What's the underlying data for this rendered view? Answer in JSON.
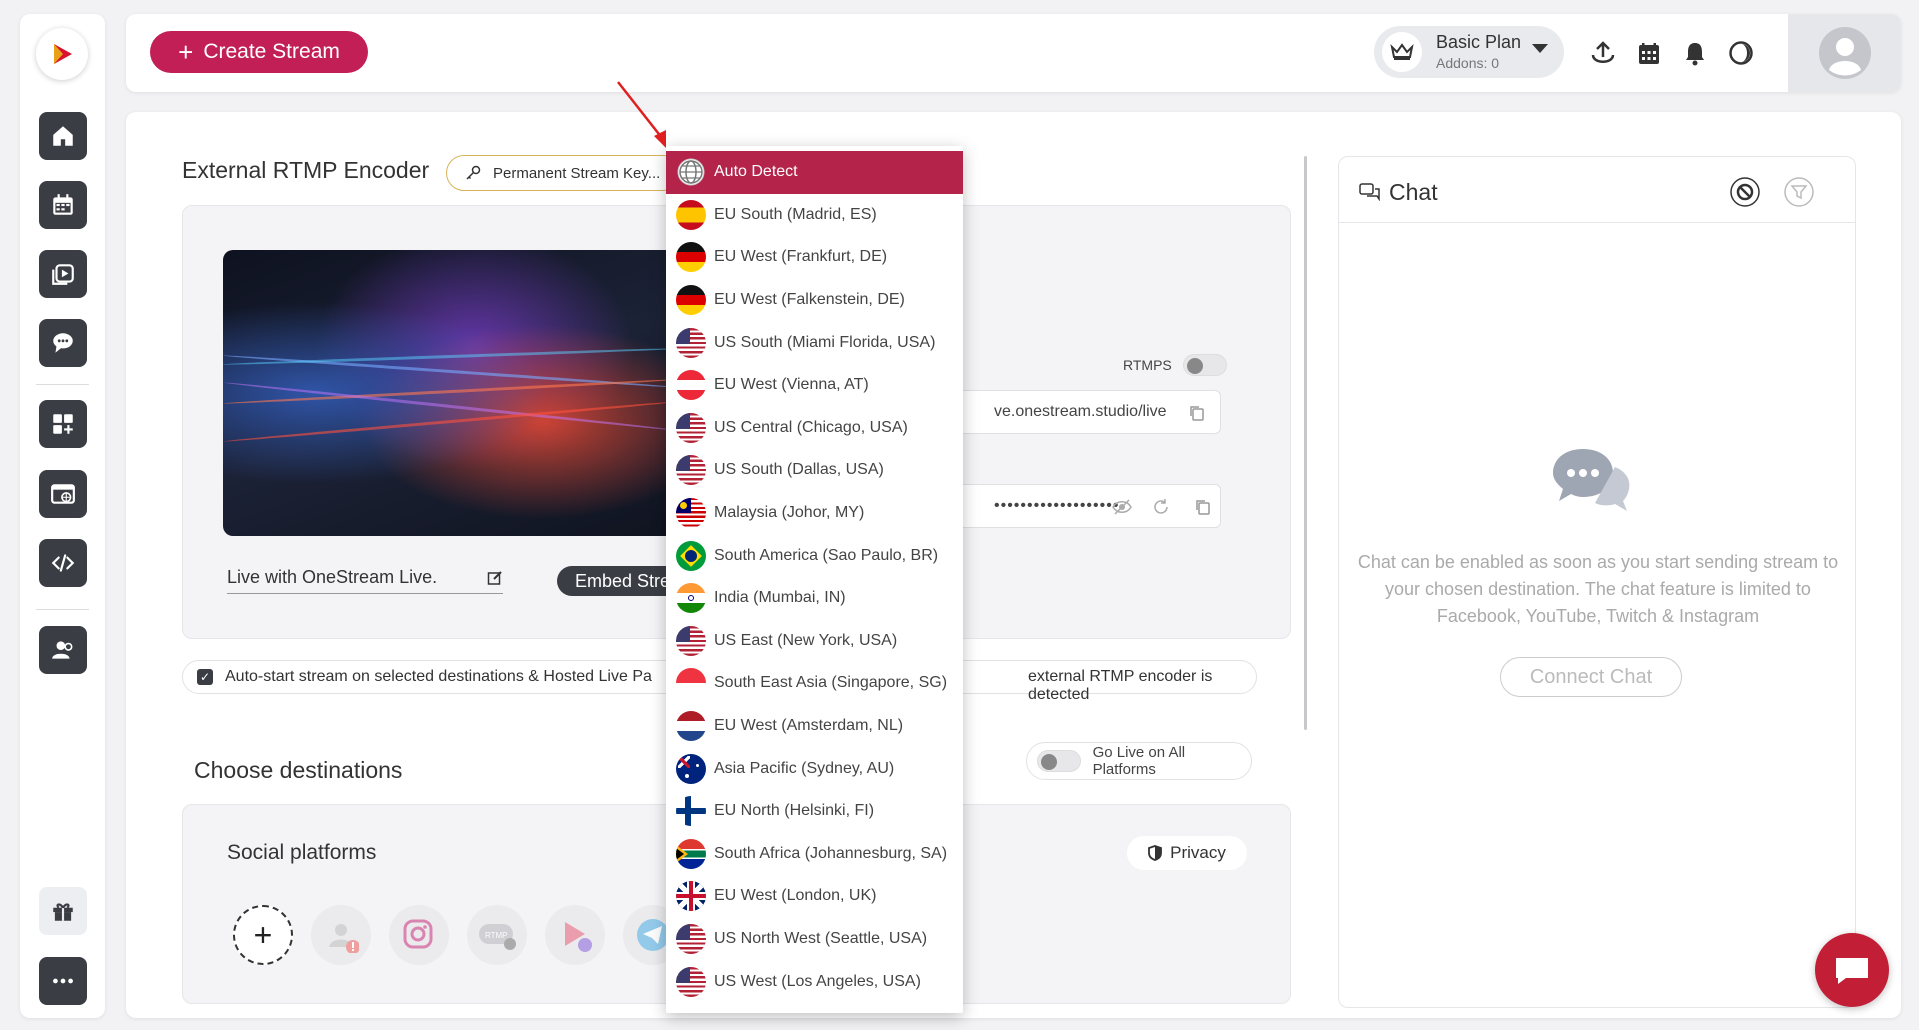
{
  "header": {
    "create_stream": "Create Stream",
    "plan_name": "Basic Plan",
    "plan_addons": "Addons: 0"
  },
  "encoder": {
    "title": "External RTMP Encoder",
    "permanent_key": "Permanent Stream Key...",
    "rtmps_label": "RTMPS",
    "server_url": "ve.onestream.studio/live",
    "stream_key_mask": "•••••••••••••••••••",
    "live_title": "Live with OneStream Live.",
    "embed_label": "Embed Stream"
  },
  "autostart": {
    "text_left": "Auto-start stream on selected destinations & Hosted Live Pa",
    "text_right": "external RTMP encoder is detected"
  },
  "destinations": {
    "title": "Choose destinations",
    "go_live_all": "Go Live on All Platforms",
    "social_title": "Social platforms",
    "privacy": "Privacy"
  },
  "chat": {
    "title": "Chat",
    "message": "Chat can be enabled as soon as you start sending stream to your chosen destination. The chat feature is limited to Facebook, YouTube, Twitch & Instagram",
    "connect": "Connect Chat"
  },
  "regions": [
    {
      "label": "Auto Detect",
      "flag": "globe"
    },
    {
      "label": "EU South (Madrid, ES)",
      "flag": "es"
    },
    {
      "label": "EU West (Frankfurt, DE)",
      "flag": "de"
    },
    {
      "label": "EU West (Falkenstein, DE)",
      "flag": "de"
    },
    {
      "label": "US South (Miami Florida, USA)",
      "flag": "us"
    },
    {
      "label": "EU West (Vienna, AT)",
      "flag": "at"
    },
    {
      "label": "US Central (Chicago, USA)",
      "flag": "us"
    },
    {
      "label": "US South (Dallas, USA)",
      "flag": "us"
    },
    {
      "label": "Malaysia (Johor, MY)",
      "flag": "my"
    },
    {
      "label": "South America (Sao Paulo, BR)",
      "flag": "br"
    },
    {
      "label": "India (Mumbai, IN)",
      "flag": "in"
    },
    {
      "label": "US East (New York, USA)",
      "flag": "us"
    },
    {
      "label": "South East Asia (Singapore, SG)",
      "flag": "sg"
    },
    {
      "label": "EU West (Amsterdam, NL)",
      "flag": "nl"
    },
    {
      "label": "Asia Pacific (Sydney, AU)",
      "flag": "au"
    },
    {
      "label": "EU North (Helsinki, FI)",
      "flag": "fi"
    },
    {
      "label": "South Africa (Johannesburg, SA)",
      "flag": "za"
    },
    {
      "label": "EU West (London, UK)",
      "flag": "uk"
    },
    {
      "label": "US North West (Seattle, USA)",
      "flag": "us"
    },
    {
      "label": "US West (Los Angeles, USA)",
      "flag": "us"
    }
  ],
  "colors": {
    "brand": "#c21f57",
    "active_region": "#b3234a",
    "dark_button": "#3a3d44"
  }
}
